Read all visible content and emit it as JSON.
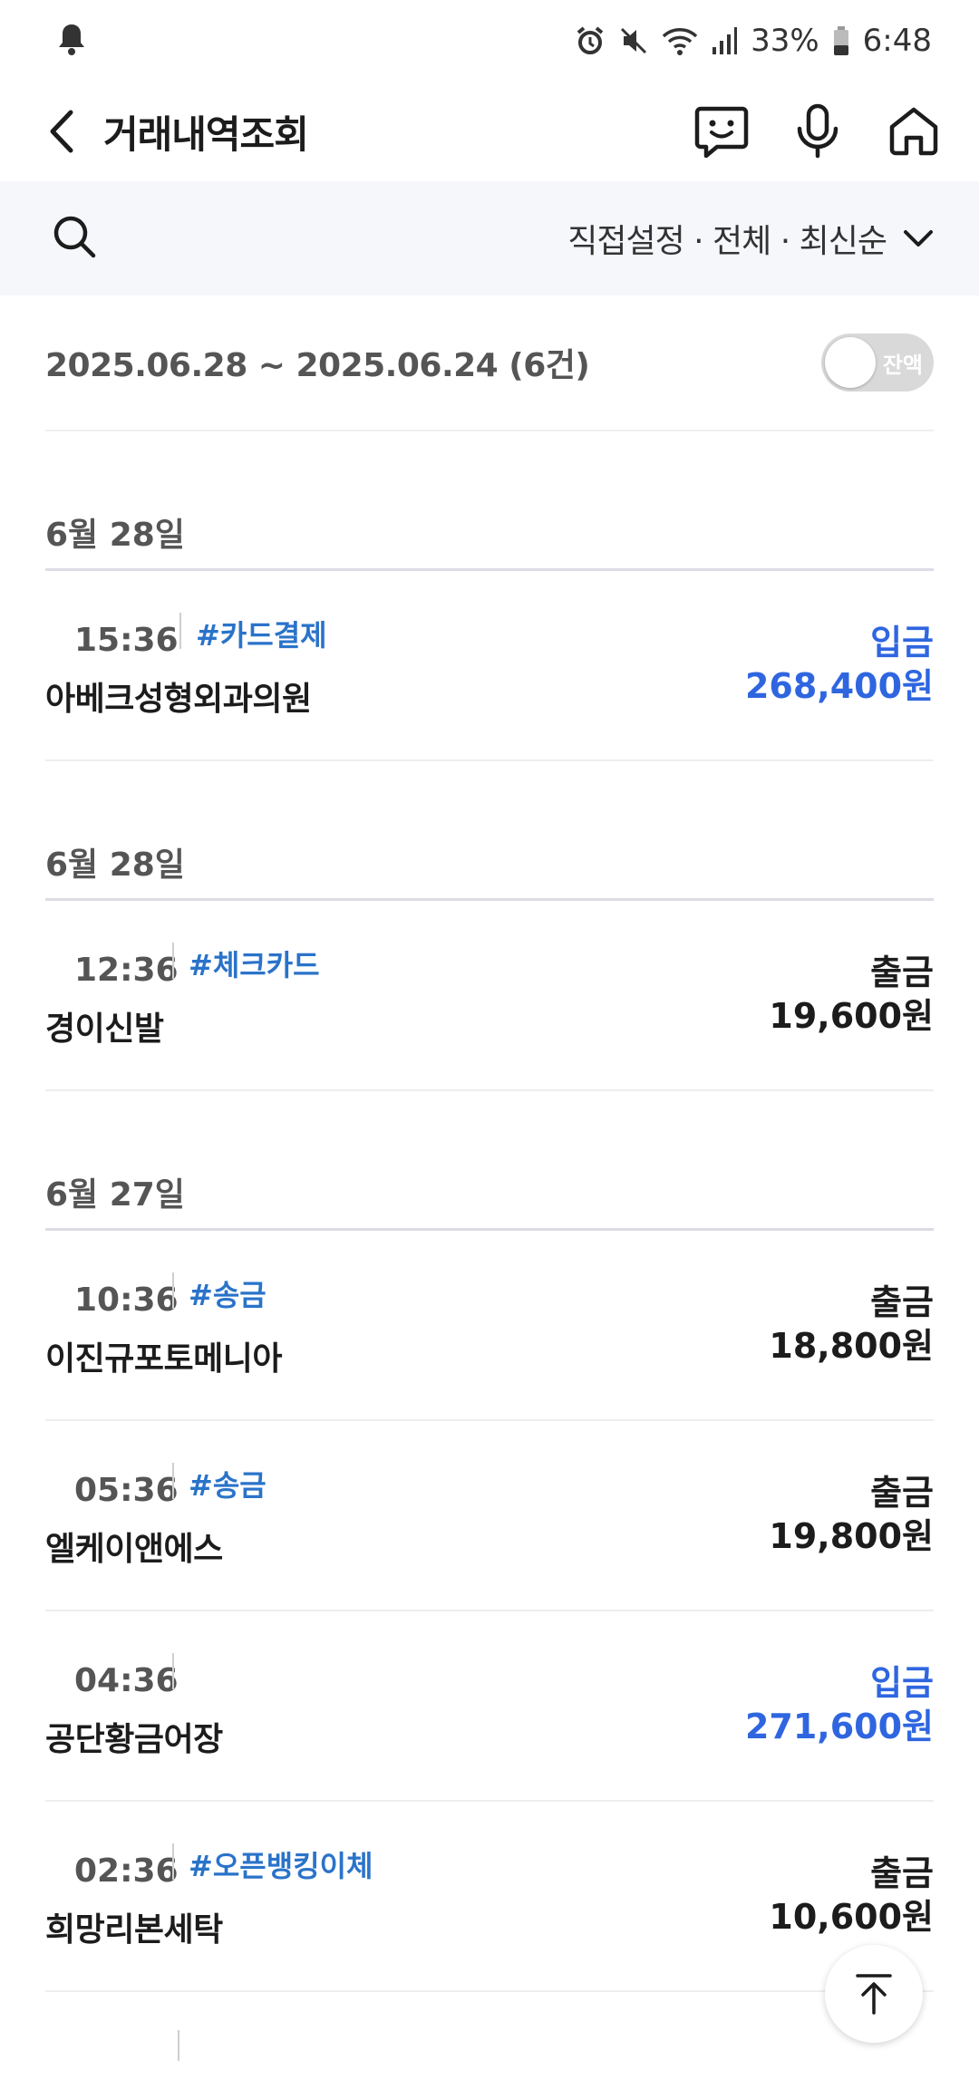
{
  "status_bar": {
    "battery": "33%",
    "time": "6:48"
  },
  "app_bar": {
    "title": "거래내역조회"
  },
  "filter": {
    "label": "직접설정 · 전체 · 최신순"
  },
  "range": {
    "text": "2025.06.28 ~ 2025.06.24 (6건)",
    "toggle_label": "잔액",
    "toggle_on": false
  },
  "colors": {
    "deposit": "#2f66e0",
    "tag": "#2a73c9",
    "filter_bg": "#f5f7fb"
  },
  "groups": [
    {
      "date": "6월 28일",
      "items": [
        {
          "time": "15:36",
          "tag": "#카드결제",
          "name": "아베크성형외과의원",
          "type": "입금",
          "amount": "268,400원",
          "kind": "deposit"
        }
      ]
    },
    {
      "date": "6월 28일",
      "items": [
        {
          "time": "12:36",
          "tag": "#체크카드",
          "name": "경이신발",
          "type": "출금",
          "amount": "19,600원",
          "kind": "withdraw"
        }
      ]
    },
    {
      "date": "6월 27일",
      "items": [
        {
          "time": "10:36",
          "tag": "#송금",
          "name": "이진규포토메니아",
          "type": "출금",
          "amount": "18,800원",
          "kind": "withdraw"
        },
        {
          "time": "05:36",
          "tag": "#송금",
          "name": "엘케이앤에스",
          "type": "출금",
          "amount": "19,800원",
          "kind": "withdraw"
        },
        {
          "time": "04:36",
          "tag": "",
          "name": "공단황금어장",
          "type": "입금",
          "amount": "271,600원",
          "kind": "deposit"
        },
        {
          "time": "02:36",
          "tag": "#오픈뱅킹이체",
          "name": "희망리본세탁",
          "type": "출금",
          "amount": "10,600원",
          "kind": "withdraw"
        }
      ]
    }
  ]
}
